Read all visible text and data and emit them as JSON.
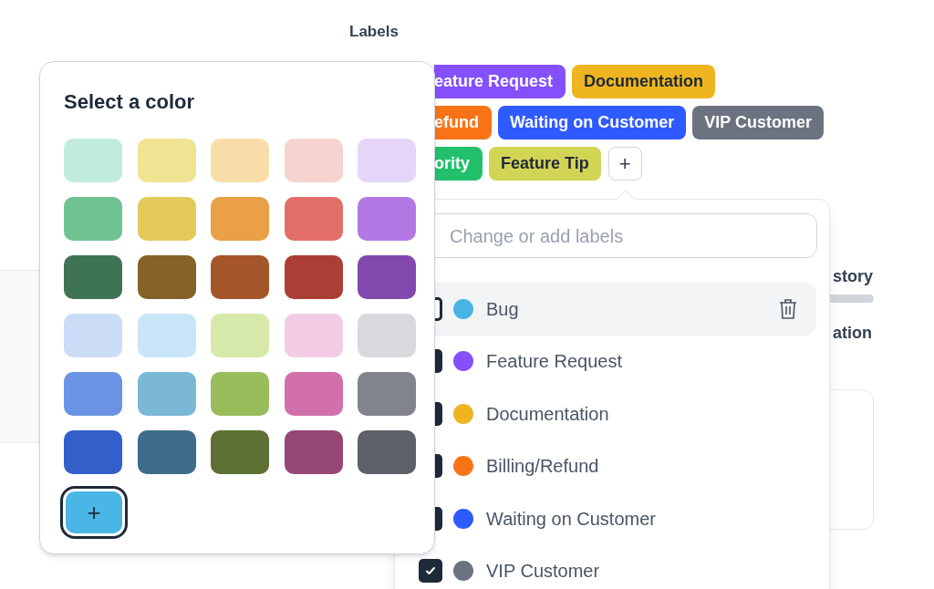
{
  "section_title": "Labels",
  "tag_rows": [
    [
      {
        "text": "eature Request",
        "color": "#8450fc",
        "cut": true
      },
      {
        "text": "Documentation",
        "color": "#efb520",
        "cut": false
      }
    ],
    [
      {
        "text": "efund",
        "color": "#f97316",
        "cut": true
      },
      {
        "text": "Waiting on Customer",
        "color": "#2e5bff",
        "cut": false
      },
      {
        "text": "VIP Customer",
        "color": "#6b7280",
        "cut": false
      }
    ],
    [
      {
        "text": "ority",
        "color": "#22c06d",
        "cut": true
      },
      {
        "text": "Feature Tip",
        "color": "#d2d456",
        "cut": false
      }
    ]
  ],
  "add_tag_button": "+",
  "background_texts": [
    "story",
    "ation"
  ],
  "color_picker": {
    "title": "Select a color",
    "swatches": [
      {
        "color": "#c1ecdb",
        "selected": false
      },
      {
        "color": "#f0e492",
        "selected": false
      },
      {
        "color": "#f7dea8",
        "selected": false
      },
      {
        "color": "#f6d3ce",
        "selected": false
      },
      {
        "color": "#e5d5f8",
        "selected": false
      },
      {
        "color": "#6fc393",
        "selected": false
      },
      {
        "color": "#e4c95b",
        "selected": false
      },
      {
        "color": "#e9a046",
        "selected": false
      },
      {
        "color": "#e26e69",
        "selected": false
      },
      {
        "color": "#b378e4",
        "selected": false
      },
      {
        "color": "#3e7453",
        "selected": false
      },
      {
        "color": "#846228",
        "selected": false
      },
      {
        "color": "#a45629",
        "selected": false
      },
      {
        "color": "#ac3f35",
        "selected": false
      },
      {
        "color": "#8348ad",
        "selected": false
      },
      {
        "color": "#cadcf6",
        "selected": false
      },
      {
        "color": "#c8e6f7",
        "selected": false
      },
      {
        "color": "#d7e9aa",
        "selected": false
      },
      {
        "color": "#f2cce4",
        "selected": false
      },
      {
        "color": "#d8d9dc",
        "selected": false
      },
      {
        "color": "#6b93e3",
        "selected": false
      },
      {
        "color": "#7bb8d6",
        "selected": false
      },
      {
        "color": "#9abd5c",
        "selected": false
      },
      {
        "color": "#d170ab",
        "selected": false
      },
      {
        "color": "#81848c",
        "selected": false
      },
      {
        "color": "#335fcb",
        "selected": false
      },
      {
        "color": "#3d6d8b",
        "selected": false
      },
      {
        "color": "#5c7033",
        "selected": false
      },
      {
        "color": "#964776",
        "selected": false
      },
      {
        "color": "#5e6169",
        "selected": false
      }
    ],
    "custom_color": {
      "label": "+",
      "color": "#49b6e5",
      "selected": true
    }
  },
  "label_menu": {
    "search": {
      "placeholder": "Change or add labels"
    },
    "items": [
      {
        "name": "Bug",
        "color": "#48b4e4",
        "checked": false,
        "hovered": true
      },
      {
        "name": "Feature Request",
        "color": "#8450fc",
        "checked": true,
        "hovered": false
      },
      {
        "name": "Documentation",
        "color": "#efb520",
        "checked": true,
        "hovered": false
      },
      {
        "name": "Billing/Refund",
        "color": "#f97316",
        "checked": true,
        "hovered": false
      },
      {
        "name": "Waiting on Customer",
        "color": "#2e5bff",
        "checked": true,
        "hovered": false
      },
      {
        "name": "VIP Customer",
        "color": "#6b7280",
        "checked": true,
        "hovered": false
      }
    ]
  }
}
